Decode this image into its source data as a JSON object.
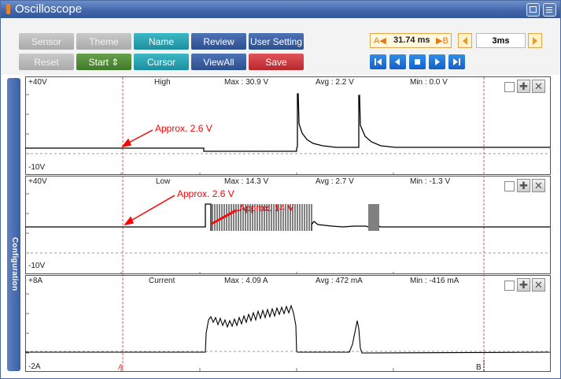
{
  "window": {
    "title": "Oscilloscope"
  },
  "toolbar": {
    "row1": [
      {
        "id": "sensor",
        "label": "Sensor",
        "style": "gray"
      },
      {
        "id": "theme",
        "label": "Theme",
        "style": "gray"
      },
      {
        "id": "name",
        "label": "Name",
        "style": "teal"
      },
      {
        "id": "review",
        "label": "Review",
        "style": "navy"
      },
      {
        "id": "user-setting",
        "label": "User Setting",
        "style": "navy"
      }
    ],
    "row2": [
      {
        "id": "reset",
        "label": "Reset",
        "style": "gray"
      },
      {
        "id": "start",
        "label": "Start ⇕",
        "style": "green"
      },
      {
        "id": "cursor",
        "label": "Cursor",
        "style": "teal"
      },
      {
        "id": "viewall",
        "label": "ViewAll",
        "style": "navy"
      },
      {
        "id": "save",
        "label": "Save",
        "style": "red"
      }
    ],
    "cursor_label_a": "A◀",
    "cursor_value": "31.74 ms",
    "cursor_label_b": "▶B",
    "timebase": "3ms",
    "playback": [
      "first-icon",
      "prev-icon",
      "stop-icon",
      "next-icon",
      "last-icon"
    ]
  },
  "sidebar": {
    "label": "Configuration"
  },
  "channels": [
    {
      "top_scale": "+40V",
      "bottom_scale": "-10V",
      "name": "High",
      "max": "Max : 30.9 V",
      "avg": "Avg : 2.2 V",
      "min": "Min : 0.0 V",
      "annotations": [
        "Approx. 2.6 V"
      ]
    },
    {
      "top_scale": "+40V",
      "bottom_scale": "-10V",
      "name": "Low",
      "max": "Max : 14.3 V",
      "avg": "Avg : 2.7 V",
      "min": "Min : -1.3 V",
      "annotations": [
        "Approx. 2.6 V",
        "Approx. 14 V"
      ]
    },
    {
      "top_scale": "+8A",
      "bottom_scale": "-2A",
      "name": "Current",
      "max": "Max : 4.09 A",
      "avg": "Avg : 472 mA",
      "min": "Min : -416 mA",
      "annotations": []
    }
  ],
  "cursors": {
    "a_label": "A",
    "b_label": "B"
  },
  "colors": {
    "trace": "#000000",
    "annotation": "#ff0000",
    "cursor": "#e05050",
    "title_bar": "#3f64a8"
  }
}
